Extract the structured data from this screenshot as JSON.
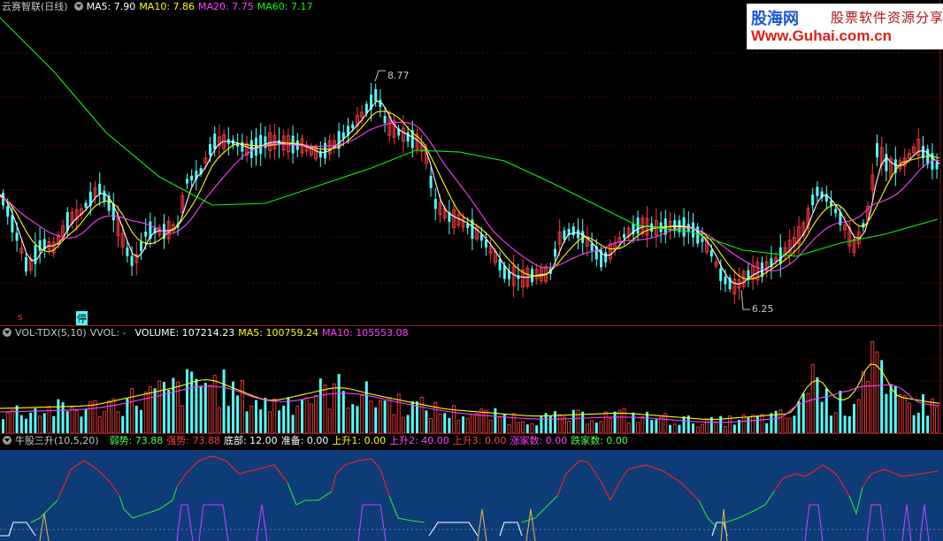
{
  "watermark": {
    "brand": "股海网",
    "slogan": "股票软件资源分享",
    "url": "Www.Guhai.com.cn"
  },
  "main_panel": {
    "title": "云赛智联(日线)",
    "ma5": "MA5: 7.90",
    "ma10": "MA10: 7.86",
    "ma20": "MA20: 7.75",
    "ma60": "MA60: 7.17",
    "high_label": "8.77",
    "low_label": "6.25",
    "marker_s": "s",
    "marker_ting": "停",
    "colors": {
      "ma5": "#ffffff",
      "ma10": "#ffff00",
      "ma20": "#ff40ff",
      "ma60": "#00ff00",
      "up": "#ff3c3c",
      "down": "#54ffff"
    }
  },
  "volume_panel": {
    "indicator": "VOL-TDX(5,10)",
    "vvol": "VVOL: -",
    "volume": "VOLUME: 107214.23",
    "ma5": "MA5: 100759.24",
    "ma10": "MA10: 105553.08"
  },
  "niugu_panel": {
    "indicator": "牛股三升(10,5,20)",
    "ruoshi": "弱势: 73.88",
    "qiangshi": "强势: 73.88",
    "dibu": "底部: 12.00",
    "zhunbei": "准备: 0.00",
    "shangsheng1": "上升1: 0.00",
    "shangsheng2": "上升2: 40.00",
    "shangsheng3": "上升3: 0.00",
    "zhangjia": "涨家数: 0.00",
    "diejia": "跌家数: 0.00"
  }
}
